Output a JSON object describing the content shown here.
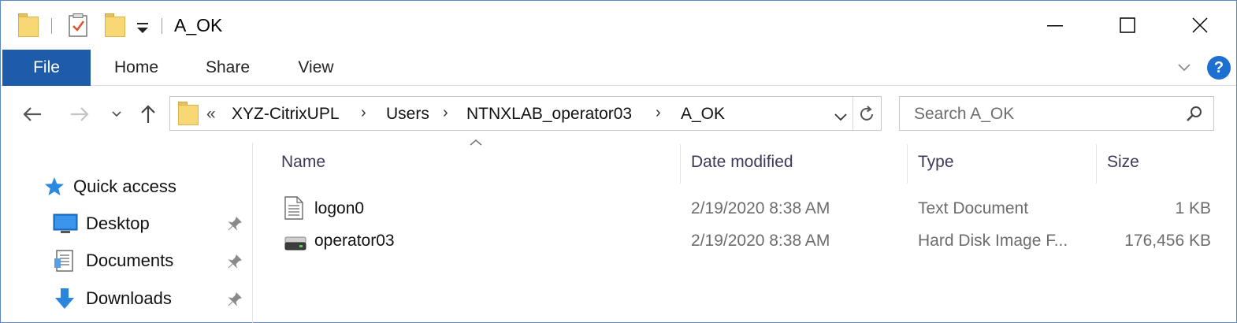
{
  "window": {
    "title": "A_OK",
    "controls": {
      "minimize": "—",
      "maximize": "☐",
      "close": "✕"
    }
  },
  "ribbon": {
    "tabs": [
      {
        "label": "File"
      },
      {
        "label": "Home"
      },
      {
        "label": "Share"
      },
      {
        "label": "View"
      }
    ],
    "help": "?"
  },
  "address": {
    "overflow": "«",
    "segments": [
      "XYZ-CitrixUPL",
      "Users",
      "NTNXLAB_operator03",
      "A_OK"
    ],
    "separator": "›"
  },
  "search": {
    "placeholder": "Search A_OK"
  },
  "navpane": {
    "items": [
      {
        "label": "Quick access",
        "icon": "star-icon"
      },
      {
        "label": "Desktop",
        "icon": "desktop-icon",
        "pinned": true
      },
      {
        "label": "Documents",
        "icon": "documents-icon",
        "pinned": true
      },
      {
        "label": "Downloads",
        "icon": "downloads-icon",
        "pinned": true
      }
    ]
  },
  "columns": {
    "name": "Name",
    "date": "Date modified",
    "type": "Type",
    "size": "Size"
  },
  "files": [
    {
      "name": "logon0",
      "date": "2/19/2020 8:38 AM",
      "type": "Text Document",
      "size": "1 KB",
      "icon": "text-document-icon"
    },
    {
      "name": "operator03",
      "date": "2/19/2020 8:38 AM",
      "type": "Hard Disk Image F...",
      "size": "176,456 KB",
      "icon": "disk-image-icon"
    }
  ],
  "colors": {
    "accent": "#1e5ba8",
    "help": "#1d6fd0",
    "folder": "#f8d775"
  }
}
